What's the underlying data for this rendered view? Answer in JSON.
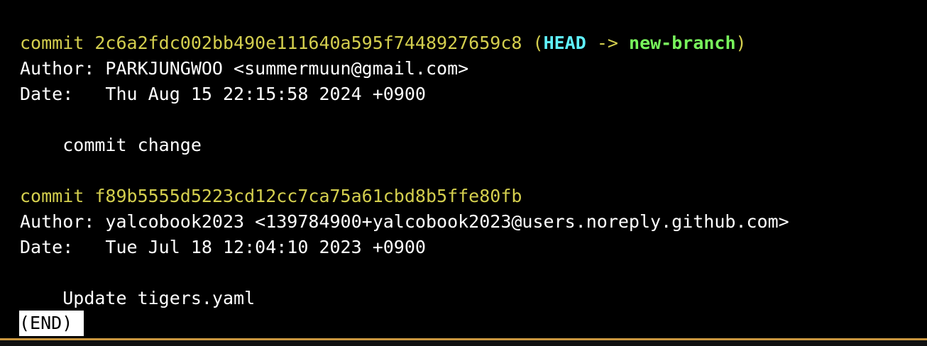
{
  "commits": [
    {
      "commit_label": "commit",
      "hash": "2c6a2fdc002bb490e111640a595f7448927659c8",
      "ref_open": "(",
      "head": "HEAD",
      "arrow": "->",
      "branch": "new-branch",
      "ref_close": ")",
      "author_label": "Author:",
      "author": "PARKJUNGWOO <summermuun@gmail.com>",
      "date_label": "Date:",
      "date": "Thu Aug 15 22:15:58 2024 +0900",
      "message": "commit change"
    },
    {
      "commit_label": "commit",
      "hash": "f89b5555d5223cd12cc7ca75a61cbd8b5ffe80fb",
      "author_label": "Author:",
      "author": "yalcobook2023 <139784900+yalcobook2023@users.noreply.github.com>",
      "date_label": "Date:",
      "date": "Tue Jul 18 12:04:10 2023 +0900",
      "message": "Update tigers.yaml"
    }
  ],
  "pager_status": "(END)",
  "colors": {
    "background": "#000000",
    "commit_hash": "#d4cf4e",
    "head": "#5ff2ff",
    "branch": "#78f55c",
    "text": "#ffffff"
  }
}
